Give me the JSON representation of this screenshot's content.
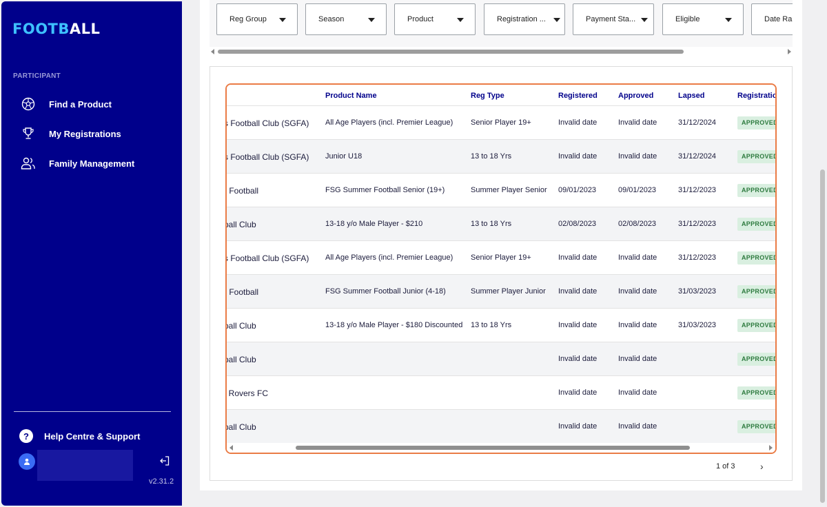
{
  "sidebar": {
    "logo_part1": "FOOTB",
    "logo_part2": "ALL",
    "section_label": "PARTICIPANT",
    "items": [
      {
        "label": "Find a Product",
        "icon": "soccer-ball-icon"
      },
      {
        "label": "My Registrations",
        "icon": "trophy-icon"
      },
      {
        "label": "Family Management",
        "icon": "people-icon"
      }
    ],
    "help_label": "Help Centre & Support",
    "version": "v2.31.2",
    "colors": {
      "background": "#00008b",
      "accent": "#3ec1ff"
    }
  },
  "filters": [
    {
      "label": "Reg Group"
    },
    {
      "label": "Season"
    },
    {
      "label": "Product"
    },
    {
      "label": "Registration ..."
    },
    {
      "label": "Payment Sta..."
    },
    {
      "label": "Eligible"
    },
    {
      "label": "Date Ran"
    }
  ],
  "table": {
    "headers": {
      "product_name": "Product Name",
      "reg_type": "Reg Type",
      "registered": "Registered",
      "approved": "Approved",
      "lapsed": "Lapsed",
      "registration": "Registratio"
    },
    "rows": [
      {
        "org": "s Football Club (SGFA)",
        "product": "All Age Players (incl. Premier League)",
        "reg_type": "Senior Player 19+",
        "registered": "Invalid date",
        "approved": "Invalid date",
        "lapsed": "31/12/2024",
        "status": "APPROVED"
      },
      {
        "org": "s Football Club (SGFA)",
        "product": "Junior U18",
        "reg_type": "13 to 18 Yrs",
        "registered": "Invalid date",
        "approved": "Invalid date",
        "lapsed": "31/12/2024",
        "status": "APPROVED"
      },
      {
        "org": "r Football",
        "product": "FSG Summer Football Senior (19+)",
        "reg_type": "Summer Player Senior",
        "registered": "09/01/2023",
        "approved": "09/01/2023",
        "lapsed": "31/12/2023",
        "status": "APPROVED"
      },
      {
        "org": "pall Club",
        "product": "13-18 y/o Male Player - $210",
        "reg_type": "13 to 18 Yrs",
        "registered": "02/08/2023",
        "approved": "02/08/2023",
        "lapsed": "31/12/2023",
        "status": "APPROVED"
      },
      {
        "org": "s Football Club (SGFA)",
        "product": "All Age Players (incl. Premier League)",
        "reg_type": "Senior Player 19+",
        "registered": "Invalid date",
        "approved": "Invalid date",
        "lapsed": "31/12/2023",
        "status": "APPROVED"
      },
      {
        "org": "r Football",
        "product": "FSG Summer Football Junior (4-18)",
        "reg_type": "Summer Player Junior",
        "registered": "Invalid date",
        "approved": "Invalid date",
        "lapsed": "31/03/2023",
        "status": "APPROVED"
      },
      {
        "org": "pall Club",
        "product": "13-18 y/o Male Player - $180 Discounted",
        "reg_type": "13 to 18 Yrs",
        "registered": "Invalid date",
        "approved": "Invalid date",
        "lapsed": "31/03/2023",
        "status": "APPROVED"
      },
      {
        "org": "pall Club",
        "product": "",
        "reg_type": "",
        "registered": "Invalid date",
        "approved": "Invalid date",
        "lapsed": "",
        "status": "APPROVED"
      },
      {
        "org": "t Rovers FC",
        "product": "",
        "reg_type": "",
        "registered": "Invalid date",
        "approved": "Invalid date",
        "lapsed": "",
        "status": "APPROVED"
      },
      {
        "org": "pall Club",
        "product": "",
        "reg_type": "",
        "registered": "Invalid date",
        "approved": "Invalid date",
        "lapsed": "",
        "status": "APPROVED"
      }
    ],
    "status_colors": {
      "approved_bg": "#d9efe0",
      "approved_text": "#2d7a3e"
    }
  },
  "pagination": {
    "label": "1 of 3",
    "next": "›"
  }
}
